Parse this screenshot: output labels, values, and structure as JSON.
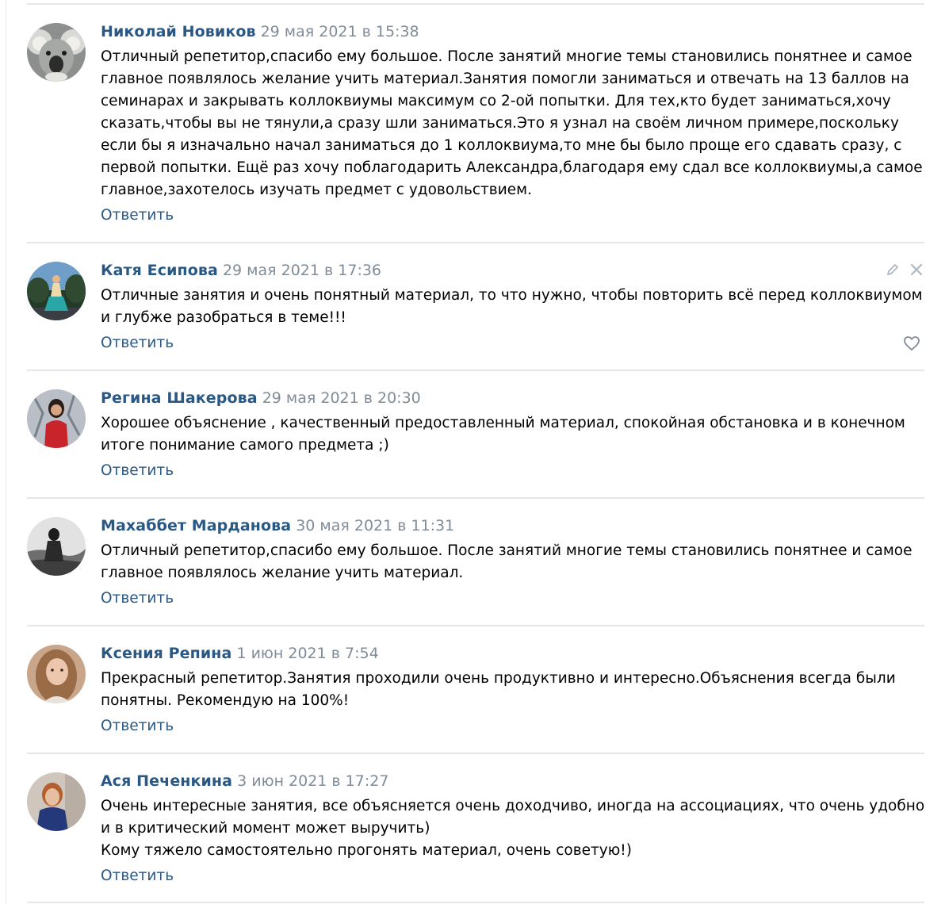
{
  "comments": [
    {
      "author": "Николай Новиков",
      "date": "29 мая 2021 в 15:38",
      "text": "Отличный репетитор,спасибо ему большое. После занятий многие темы становились понятнее и самое главное появлялось желание учить материал.Занятия помогли заниматься и отвечать на 13 баллов на семинарах и закрывать коллоквиумы максимум со 2-ой попытки. Для тех,кто будет заниматься,хочу сказать,чтобы вы не тянули,а сразу шли заниматься.Это я узнал на своём личном примере,поскольку если бы я изначально начал заниматься до 1 коллоквиума,то мне бы было проще его сдавать сразу, с первой попытки. Ещё раз хочу поблагодарить Александра,благодаря ему сдал все коллоквиумы,а самое главное,захотелось изучать предмет с удовольствием.",
      "reply": "Ответить"
    },
    {
      "author": "Катя Есипова",
      "date": "29 мая 2021 в 17:36",
      "text": "Отличные занятия и очень понятный материал, то что нужно, чтобы повторить всё перед коллоквиумом и глубже разобраться в теме!!!",
      "reply": "Ответить"
    },
    {
      "author": "Регина Шакерова",
      "date": "29 мая 2021 в 20:30",
      "text": "Хорошее объяснение , качественный предоставленный материал, спокойная обстановка и в конечном итоге понимание самого предмета ;)",
      "reply": "Ответить"
    },
    {
      "author": "Махаббет Марданова",
      "date": "30 мая 2021 в 11:31",
      "text": "Отличный репетитор,спасибо ему большое. После занятий многие темы становились понятнее и самое главное появлялось желание учить материал.",
      "reply": "Ответить"
    },
    {
      "author": "Ксения Репина",
      "date": "1 июн 2021 в 7:54",
      "text": "Прекрасный репетитор.Занятия проходили очень продуктивно и интересно.Объяснения всегда были понятны. Рекомендую на 100%!",
      "reply": "Ответить"
    },
    {
      "author": "Ася Печенкина",
      "date": "3 июн 2021 в 17:27",
      "text": "Очень интересные занятия, все объясняется очень доходчиво, иногда на ассоциациях, что очень удобно и в критический момент может выручить)\nКому тяжело самостоятельно прогонять материал, очень советую!)",
      "reply": "Ответить"
    }
  ],
  "icons": {
    "edit": "pencil-icon",
    "delete": "close-icon",
    "like": "heart-icon"
  },
  "colors": {
    "author": "#2a5885",
    "date": "#818c99",
    "link": "#2a5885",
    "divider": "#e4e6ea",
    "icon": "#aeb7c2"
  }
}
